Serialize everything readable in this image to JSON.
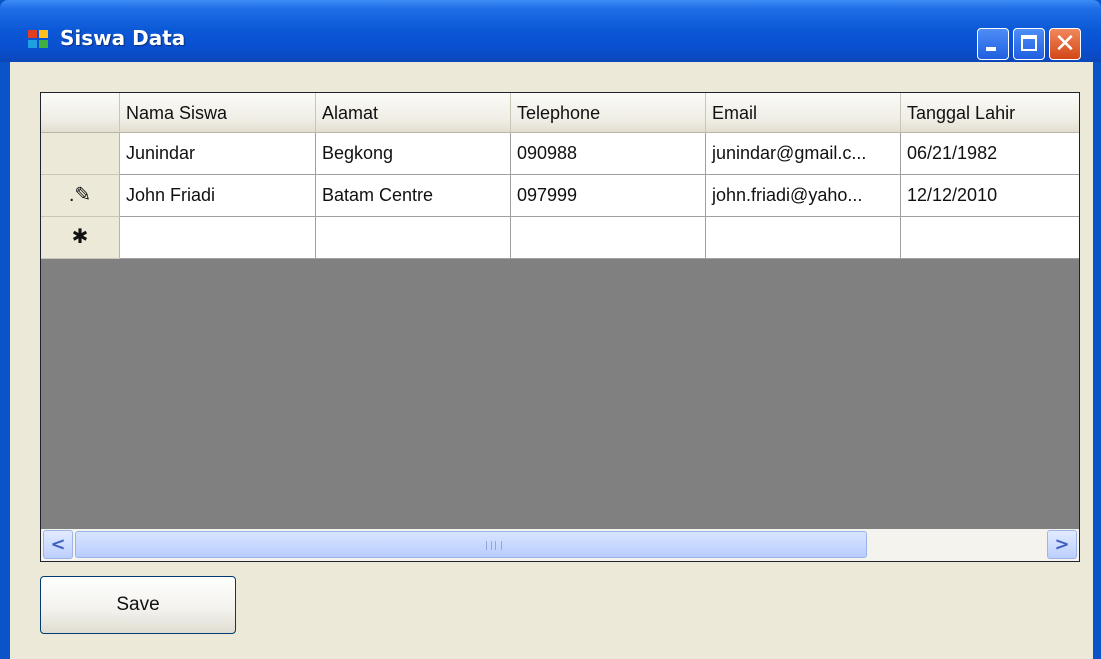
{
  "window": {
    "title": "Siswa Data",
    "colors": {
      "titlebar": "#0a53c8",
      "client": "#ece9d8",
      "grid_background": "#808080"
    }
  },
  "grid": {
    "columns": [
      "Nama Siswa",
      "Alamat",
      "Telephone",
      "Email",
      "Tanggal Lahir"
    ],
    "rows": [
      {
        "indicator": "",
        "cells": [
          "Junindar",
          "Begkong",
          "090988",
          "junindar@gmail.c...",
          "06/21/1982"
        ]
      },
      {
        "indicator": ".✎",
        "cells": [
          "John Friadi",
          "Batam Centre",
          "097999",
          "john.friadi@yaho...",
          "12/12/2010"
        ]
      },
      {
        "indicator": "✱",
        "cells": [
          "",
          "",
          "",
          "",
          ""
        ]
      }
    ]
  },
  "scrollbar": {
    "left_arrow": "<",
    "right_arrow": ">"
  },
  "buttons": {
    "save": "Save"
  },
  "icons": {
    "app": "form-icon",
    "minimize": "minimize-icon",
    "maximize": "maximize-icon",
    "close": "close-icon"
  }
}
